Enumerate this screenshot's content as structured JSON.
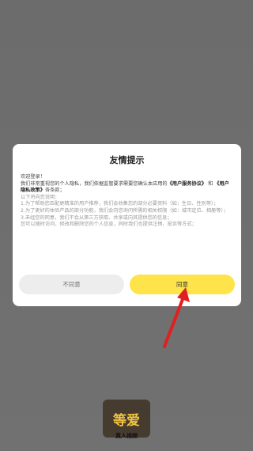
{
  "dialog": {
    "title": "友情提示",
    "greeting": "欢迎登录！",
    "intro_before": "我们非常重视您的个人隐私，我们依据监管要求需要您确认本应用的",
    "agreement_link": "《用户服务协议》",
    "and_text": "和",
    "privacy_link": "《用户隐私政策》",
    "intro_after": "各条款；",
    "lines": [
      "以下将向您说明：",
      "1.为了帮助您匹配更精准的用户推荐，我们会收集您的部分必要资料（如：生日、性别等）；",
      "2.为了更好的体验产品的部分功能，我们会向您询问所需的相关权限（如：城市定位、相册等）；",
      "3.未经您的同意，我们不会从第三方获取、共享或向其提供您的信息；",
      "您可以随时访问、修改和删除您的个人信息，同时我们也提供注销、投诉等方式；"
    ],
    "disagree_label": "不同意",
    "agree_label": "同意"
  },
  "app": {
    "icon_text": "等爱",
    "name": "真人视频"
  },
  "colors": {
    "accent": "#ffe34a",
    "arrow": "#e02020"
  }
}
